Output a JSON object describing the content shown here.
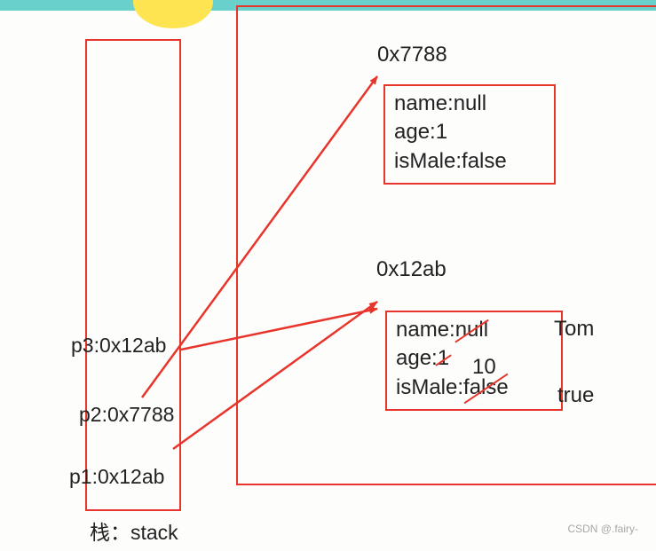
{
  "stack": {
    "label": "栈：stack",
    "entries": {
      "p3": "p3:0x12ab",
      "p2": "p2:0x7788",
      "p1": "p1:0x12ab"
    }
  },
  "heap": {
    "obj1": {
      "addr": "0x7788",
      "name": "name:null",
      "age": "age:1",
      "isMale": "isMale:false"
    },
    "obj2": {
      "addr": "0x12ab",
      "name_prefix": "name:",
      "name_old": "null",
      "age_prefix": "age:",
      "age_old": "1",
      "isMale_prefix": "isMale:",
      "isMale_old": "false",
      "name_new": "Tom",
      "age_new": "10",
      "isMale_new": "true"
    }
  },
  "watermark": "CSDN @.fairy-"
}
